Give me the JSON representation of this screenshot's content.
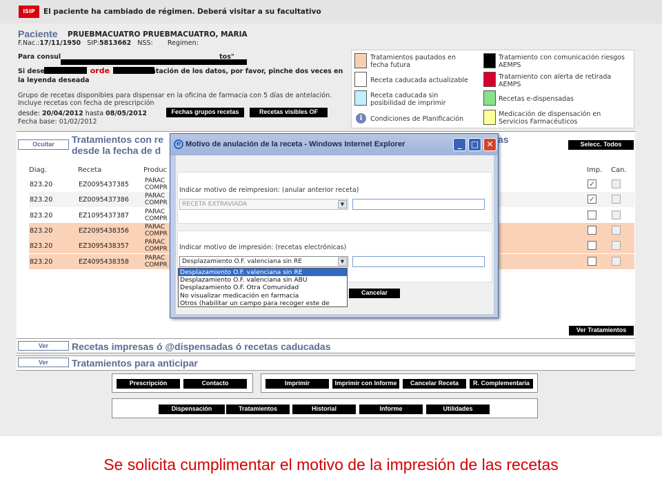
{
  "header": {
    "logo": "ISIP",
    "alert": "El paciente ha cambiado de régimen. Deberá visitar a su facultativo"
  },
  "patient": {
    "title": "Paciente",
    "name": "PRUEBMACUATRO PRUEBMACUATRO, MARIA",
    "fnac_label": "F.Nac.:",
    "fnac": "17/11/1950",
    "sip_label": "SIP:",
    "sip": "5813662",
    "nss_label": "NSS:",
    "regimen_label": "Regimen:"
  },
  "info": {
    "consult_start": "Para consul",
    "consult_end": "tos\"",
    "sidesea_start": "Si dese",
    "orde": "orde",
    "sidesea_end": "ntación de los datos, por favor, pinche dos veces en",
    "sidesea_line2": "la leyenda deseada",
    "grupo": "Grupo de recetas disponibles para dispensar en la oficina de farmacia con 5 días de antelación. Incluye recetas con fecha de prescripción",
    "desde_label": "desde:",
    "desde": "20/04/2012",
    "hasta_label": "hasta",
    "hasta": "08/05/2012",
    "fechas_btn": "Fechas grupos recetas",
    "visibles_btn": "Recetas visibles OF",
    "fbase_label": "Fecha base:",
    "fbase": "01/02/2012"
  },
  "legend": [
    {
      "label": "Tratamientos pautados en fecha futura",
      "color": "#f9cfb3"
    },
    {
      "label": "Tratamiento con comunicación riesgos AEMPS",
      "color": "#000000"
    },
    {
      "label": "Receta caducada actualizable",
      "color": "#ffffff"
    },
    {
      "label": "Tratamiento con alerta de retirada AEMPS",
      "color": "#d6002a"
    },
    {
      "label": "Receta caducada sin posibilidad de imprimir",
      "color": "#bff0ff"
    },
    {
      "label": "Recetas e-dispensadas",
      "color": "#88e088"
    },
    {
      "label": "Condiciones de Planificación",
      "color": ""
    },
    {
      "label": "Medicación de dispensación en Servicios Farmacéuticos",
      "color": "#ffff99"
    }
  ],
  "main": {
    "ocultar": "Ocultar",
    "title_start": "Tratamientos con re",
    "title_line2": "desde la fecha de d",
    "title_end": "as",
    "selecc": "Selecc. Todos",
    "columns": {
      "diag": "Diag.",
      "receta": "Receta",
      "product": "Produc",
      "imp": "Imp.",
      "can": "Can."
    },
    "rows": [
      {
        "diag": "823.20",
        "receta": "EZ0095437385",
        "p1": "PARAC",
        "p2": "COMPR",
        "imp": true,
        "color": "#ffffff"
      },
      {
        "diag": "823.20",
        "receta": "EZ0095437386",
        "p1": "PARAC",
        "p2": "COMPR",
        "imp": true,
        "color": "#f3f3f3"
      },
      {
        "diag": "823.20",
        "receta": "EZ1095437387",
        "p1": "PARAC",
        "p2": "COMPR",
        "imp": false,
        "color": "#ffffff"
      },
      {
        "diag": "823.20",
        "receta": "EZ2095438356",
        "p1": "PARAC",
        "p2": "COMPR",
        "imp": false,
        "color": "#f9d2b8"
      },
      {
        "diag": "823.20",
        "receta": "EZ3095438357",
        "p1": "PARAC",
        "p2": "COMPR",
        "imp": false,
        "color": "#f9d2b8"
      },
      {
        "diag": "823.20",
        "receta": "EZ4095438358",
        "p1": "PARAC",
        "p2": "COMPR",
        "imp": false,
        "color": "#f9d2b8"
      }
    ],
    "ver_trat": "Ver Tratamientos"
  },
  "panels": [
    {
      "btn": "Ver",
      "title": "Recetas impresas ó @dispensadas ó recetas caducadas"
    },
    {
      "btn": "Ver",
      "title": "Tratamientos para anticipar"
    }
  ],
  "modal": {
    "title": "Motivo de anulación de la receta - Windows Internet Explorer",
    "reimp_label": "Indicar motivo de reimpresion: (anular anterior receta)",
    "reimp_value": "RECETA EXTRAVIADA",
    "imp_label": "Indicar motivo de impresión: (recetas electrónicas)",
    "imp_value": "Desplazamiento O.F. valenciana sin RE",
    "cancel": "Cancelar",
    "options": [
      "Desplazamiento O.F. valenciana sin RE",
      "Desplazamiento O.F. valenciana sin ABU",
      "Desplazamiento O.F. Otra Comunidad",
      "No visualizar medicación en farmacia",
      "Otros (habilitar un campo para recoger este de"
    ]
  },
  "toolbar1": {
    "prescripcion": "Prescripción",
    "contacto": "Contacto",
    "imprimir": "Imprimir",
    "imprimir_informe": "Imprimir con Informe",
    "cancelar": "Cancelar Receta",
    "complementaria": "R. Complementaria"
  },
  "toolbar2": {
    "dispensacion": "Dispensación",
    "tratamientos": "Tratamientos",
    "historial": "Historial",
    "informe": "Informe",
    "utilidades": "Utilidades"
  },
  "caption": "Se solicita cumplimentar el motivo de la impresión de las recetas"
}
